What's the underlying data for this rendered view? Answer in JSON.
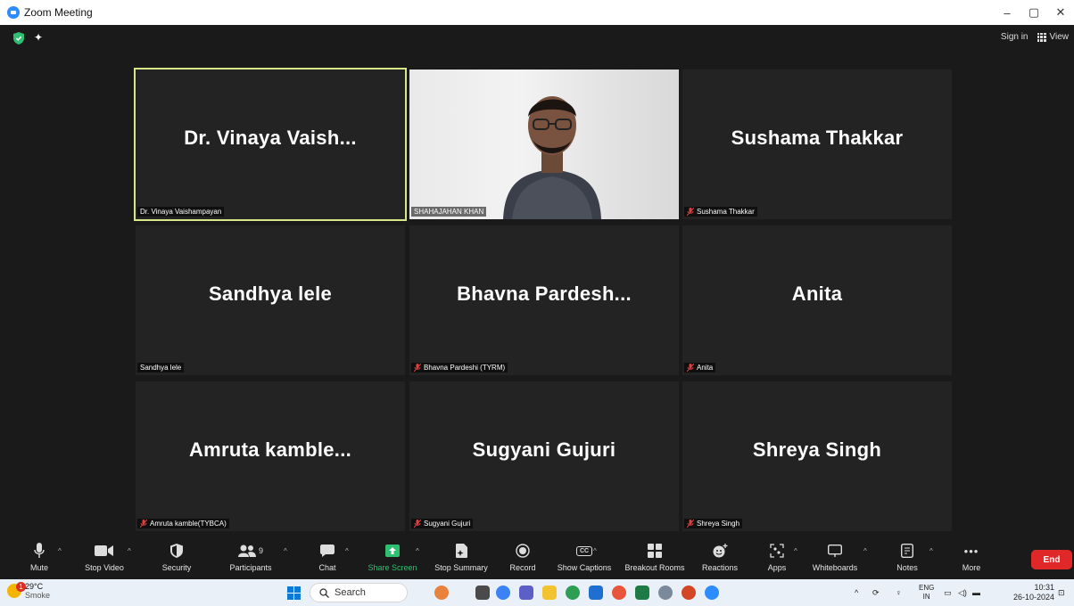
{
  "window": {
    "title": "Zoom Meeting",
    "controls": [
      "–",
      "▢",
      "✕"
    ]
  },
  "topbar": {
    "sign_in": "Sign in",
    "view": "View"
  },
  "tiles": [
    {
      "big_name": "Dr. Vinaya Vaish...",
      "label": "Dr. Vinaya Vaishampayan",
      "muted": false,
      "active": true
    },
    {
      "big_name": "",
      "label": "SHAHAJAHAN KHAN",
      "muted": false,
      "video": true
    },
    {
      "big_name": "Sushama Thakkar",
      "label": "Sushama Thakkar",
      "muted": true
    },
    {
      "big_name": "Sandhya lele",
      "label": "Sandhya lele",
      "muted": false
    },
    {
      "big_name": "Bhavna  Pardesh...",
      "label": "Bhavna Pardeshi (TYRM)",
      "muted": true
    },
    {
      "big_name": "Anita",
      "label": "Anita",
      "muted": true
    },
    {
      "big_name": "Amruta  kamble...",
      "label": "Amruta kamble(TYBCA)",
      "muted": true
    },
    {
      "big_name": "Sugyani Gujuri",
      "label": "Sugyani Gujuri",
      "muted": true
    },
    {
      "big_name": "Shreya Singh",
      "label": "Shreya Singh",
      "muted": true
    }
  ],
  "toolbar": {
    "mute": "Mute",
    "stop_video": "Stop Video",
    "security": "Security",
    "participants": "Participants",
    "participants_count": "9",
    "chat": "Chat",
    "share_screen": "Share Screen",
    "stop_summary": "Stop Summary",
    "record": "Record",
    "show_captions": "Show Captions",
    "breakout_rooms": "Breakout Rooms",
    "reactions": "Reactions",
    "apps": "Apps",
    "whiteboards": "Whiteboards",
    "notes": "Notes",
    "more": "More",
    "end": "End",
    "cc": "CC"
  },
  "taskbar": {
    "weather_temp": "29°C",
    "weather_desc": "Smoke",
    "weather_badge": "1",
    "search_placeholder": "Search",
    "lang_top": "ENG",
    "lang_bottom": "IN",
    "time": "10:31",
    "date": "26-10-2024"
  },
  "colors": {
    "active_speaker_border": "#d7e88a",
    "share_green": "#2fbf71",
    "end_red": "#e02828",
    "muted_red": "#e04040"
  }
}
